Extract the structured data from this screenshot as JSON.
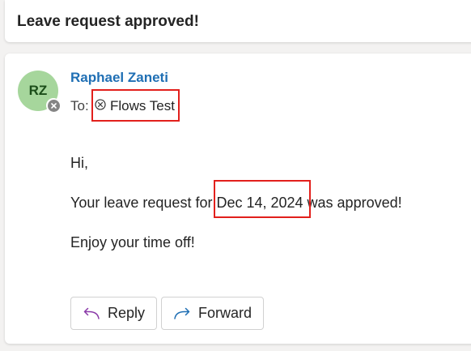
{
  "email": {
    "subject": "Leave request approved!",
    "sender": {
      "initials": "RZ",
      "name": "Raphael Zaneti",
      "avatar_color": "#a6d69c",
      "presence_icon": "offline-x-icon"
    },
    "to_label": "To:",
    "recipient": "Flows Test",
    "recipient_icon": "circle-x-icon",
    "body": {
      "greeting": "Hi,",
      "line1_prefix": "Your leave request for ",
      "line1_date": "Dec 14, 2024",
      "line1_suffix": " was approved!",
      "line2": "Enjoy your time off!"
    },
    "actions": {
      "reply_label": "Reply",
      "reply_icon": "reply-arrow-icon",
      "forward_label": "Forward",
      "forward_icon": "forward-arrow-icon"
    },
    "highlight_color": "#e2201c",
    "link_color": "#1f6fb4"
  }
}
